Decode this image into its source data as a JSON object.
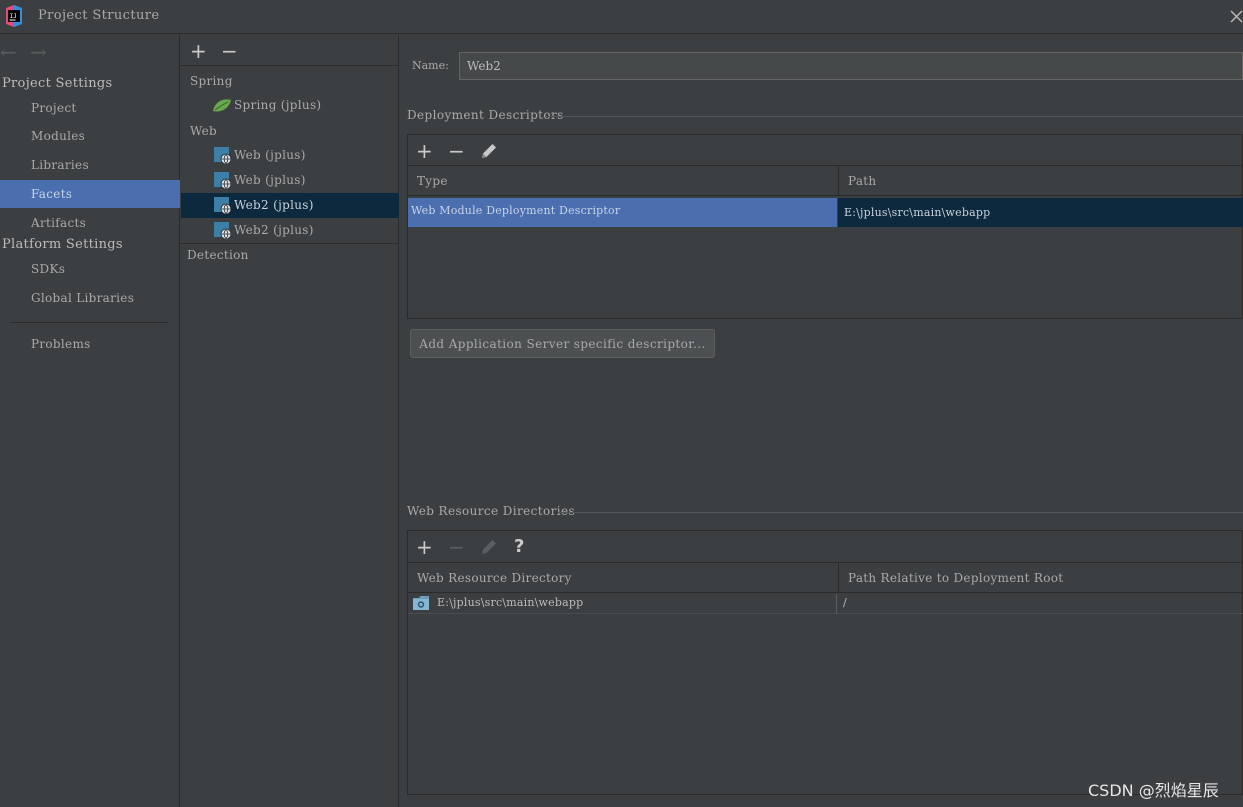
{
  "window": {
    "title": "Project Structure"
  },
  "left_panel": {
    "project_settings_title": "Project Settings",
    "project_items": [
      "Project",
      "Modules",
      "Libraries",
      "Facets",
      "Artifacts"
    ],
    "platform_settings_title": "Platform Settings",
    "platform_items": [
      "SDKs",
      "Global Libraries"
    ],
    "problems": "Problems"
  },
  "facet_tree": {
    "groups": {
      "spring": "Spring",
      "web": "Web",
      "detection": "Detection"
    },
    "spring_items": [
      "Spring (jplus)"
    ],
    "web_items": [
      "Web (jplus)",
      "Web (jplus)",
      "Web2 (jplus)",
      "Web2 (jplus)"
    ]
  },
  "form": {
    "name_label": "Name:",
    "name_value": "Web2"
  },
  "deployment_descriptors": {
    "title": "Deployment Descriptors",
    "columns": [
      "Type",
      "Path"
    ],
    "rows": [
      {
        "type": "Web Module Deployment Descriptor",
        "path": "E:\\jplus\\src\\main\\webapp"
      }
    ],
    "add_button": "Add Application Server specific descriptor..."
  },
  "web_resources": {
    "title": "Web Resource Directories",
    "columns": [
      "Web Resource Directory",
      "Path Relative to Deployment Root"
    ],
    "rows": [
      {
        "directory": "E:\\jplus\\src\\main\\webapp",
        "relative_path": "/"
      }
    ]
  },
  "watermark": "CSDN @烈焰星辰",
  "colors": {
    "background": "#3c3f41",
    "selection": "#4b6eaf",
    "tree_selection": "#0d293e",
    "spring_green": "#6aa84f",
    "web_icon_blue": "#3d7fa7"
  }
}
